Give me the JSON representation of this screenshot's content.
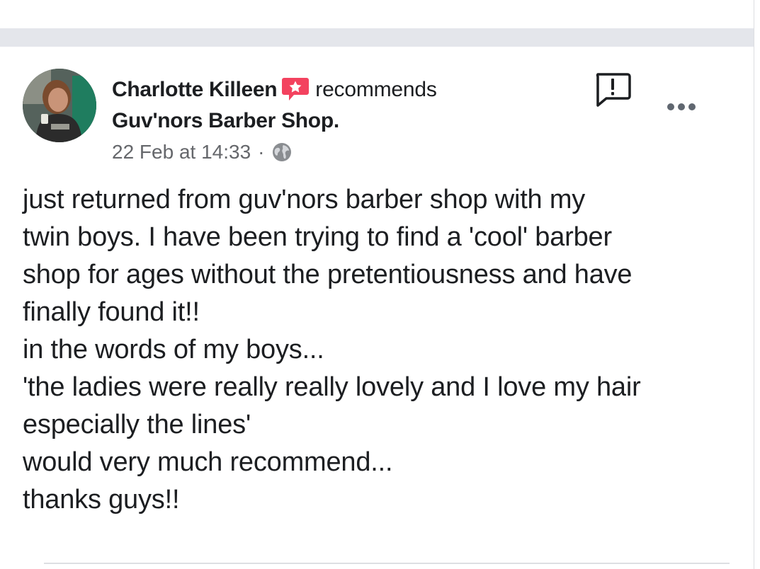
{
  "post": {
    "author": "Charlotte Killeen",
    "action": "recommends",
    "page_name": "Guv'nors Barber Shop.",
    "timestamp": "22 Feb at 14:33",
    "separator": "·",
    "audience_icon": "globe-icon",
    "body_lines": [
      "just returned from guv'nors barber shop with my",
      "twin boys. I have been trying to find a 'cool' barber",
      "shop for ages without the pretentiousness and have",
      "finally found it!!",
      "in the words of my boys...",
      "'the ladies were really really lovely and I love my hair",
      "especially the lines'",
      "would very much recommend...",
      "thanks guys!!"
    ]
  },
  "icons": {
    "recommend": "recommend-badge-icon",
    "report": "report-icon",
    "more": "more-options-icon"
  },
  "colors": {
    "text": "#1c1e21",
    "secondary_text": "#65676b",
    "recommend_badge": "#f3425f",
    "band": "#e4e6eb"
  }
}
